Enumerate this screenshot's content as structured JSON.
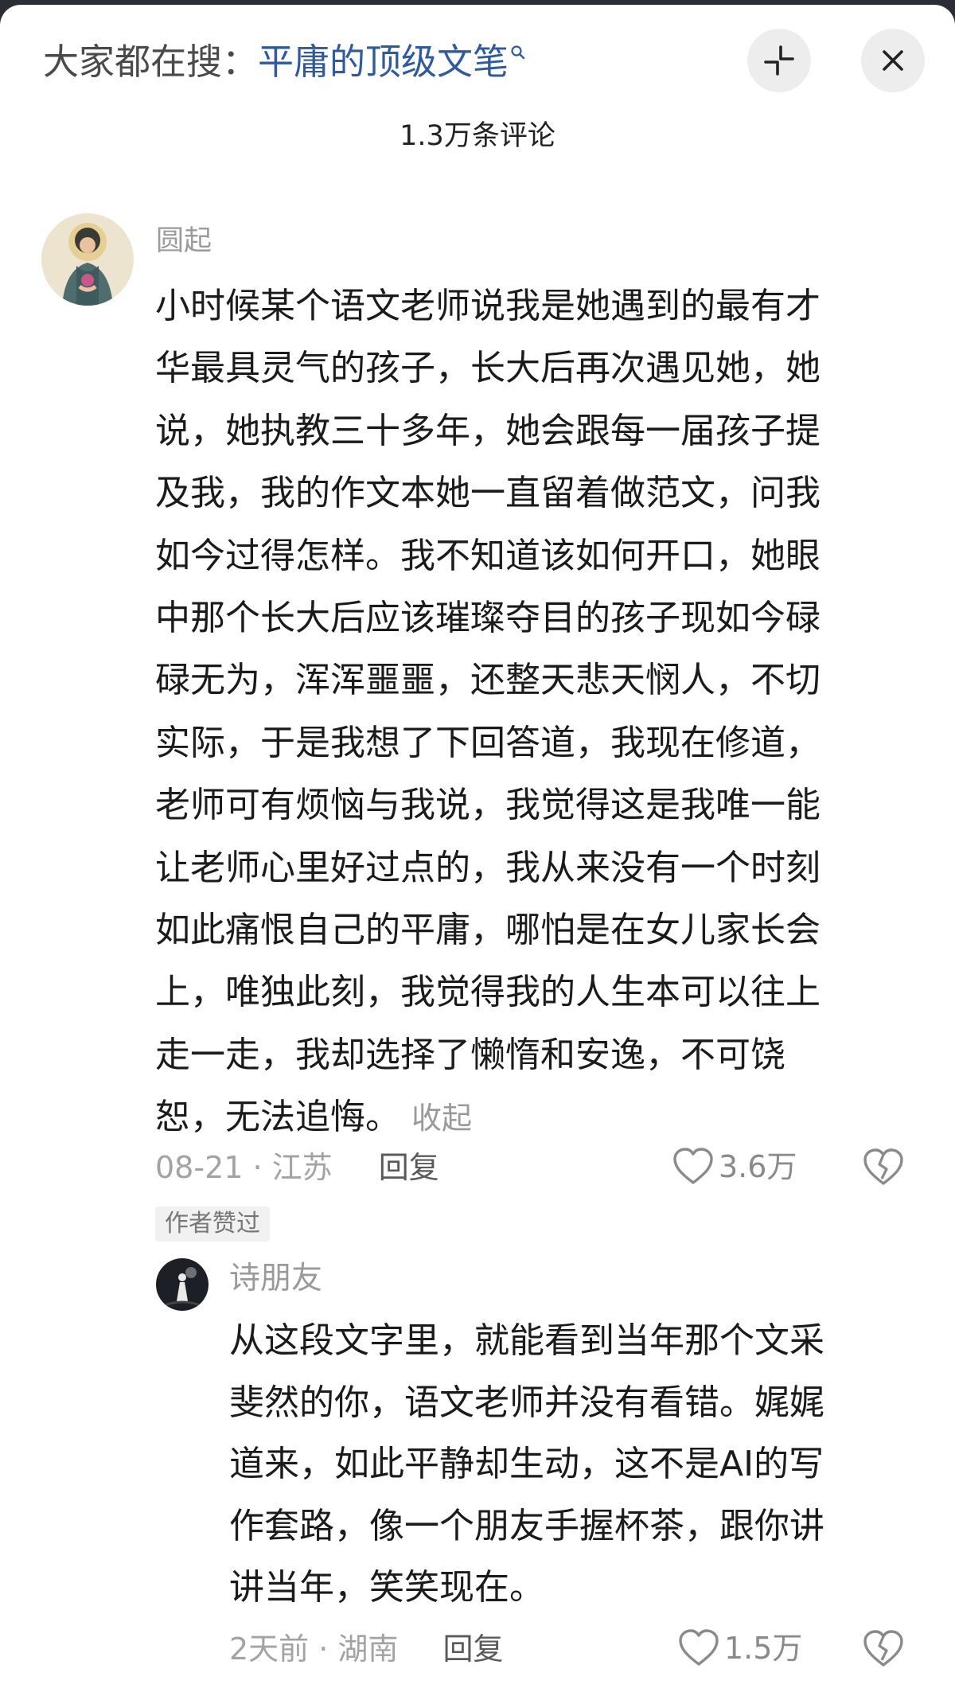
{
  "header": {
    "hot_search_prefix": "大家都在搜：",
    "hot_search_term": "平庸的顶级文笔",
    "comment_count_title": "1.3万条评论"
  },
  "icons": {
    "hot_search": "search-icon",
    "collapse": "minimize-arrows-icon",
    "close": "close-icon",
    "like": "heart-icon",
    "dislike": "broken-heart-icon"
  },
  "comments": [
    {
      "user": "圆起",
      "lines": [
        "小时候某个语文老师说我是她遇到的最有才",
        "华最具灵气的孩子，长大后再次遇见她，她",
        "说，她执教三十多年，她会跟每一届孩子提",
        "及我，我的作文本她一直留着做范文，问我",
        "如今过得怎样。我不知道该如何开口，她眼",
        "中那个长大后应该璀璨夺目的孩子现如今碌",
        "碌无为，浑浑噩噩，还整天悲天悯人，不切",
        "实际，于是我想了下回答道，我现在修道，",
        "老师可有烦恼与我说，我觉得这是我唯一能",
        "让老师心里好过点的，我从来没有一个时刻",
        "如此痛恨自己的平庸，哪怕是在女儿家长会",
        "上，唯独此刻，我觉得我的人生本可以往上",
        "走一走，我却选择了懒惰和安逸，不可饶",
        "恕，无法追悔。"
      ],
      "collapse_label": "收起",
      "time_location": "08-21 · 江苏",
      "reply_label": "回复",
      "likes": "3.6万",
      "badge": "作者赞过"
    },
    {
      "user": "诗朋友",
      "lines": [
        "从这段文字里，就能看到当年那个文采",
        "斐然的你，语文老师并没有看错。娓娓",
        "道来，如此平静却生动，这不是AI的写",
        "作套路，像一个朋友手握杯茶，跟你讲",
        "讲当年，笑笑现在。"
      ],
      "time_location": "2天前 · 湖南",
      "reply_label": "回复",
      "likes": "1.5万"
    }
  ],
  "colors": {
    "link_blue": "#2f5b9c",
    "meta_gray": "#a3a3a3",
    "button_bg": "#ededed"
  }
}
